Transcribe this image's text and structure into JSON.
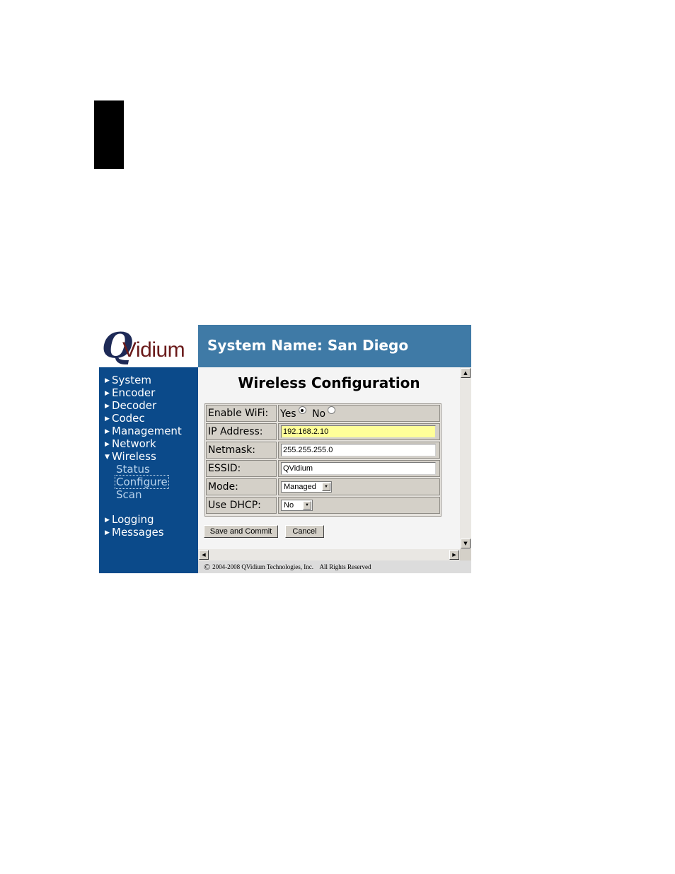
{
  "logo": {
    "initial": "Q",
    "word": "Vidium"
  },
  "banner": {
    "title": "System Name: San Diego"
  },
  "nav": {
    "items": [
      {
        "label": "System",
        "arrow": "▶"
      },
      {
        "label": "Encoder",
        "arrow": "▶"
      },
      {
        "label": "Decoder",
        "arrow": "▶"
      },
      {
        "label": "Codec",
        "arrow": "▶"
      },
      {
        "label": "Management",
        "arrow": "▶"
      },
      {
        "label": "Network",
        "arrow": "▶"
      },
      {
        "label": "Wireless",
        "arrow": "▼"
      },
      {
        "label": "Logging",
        "arrow": "▶"
      },
      {
        "label": "Messages",
        "arrow": "▶"
      }
    ],
    "wireless_sub": [
      "Status",
      "Configure",
      "Scan"
    ],
    "selected_sub": "Configure"
  },
  "page": {
    "title": "Wireless Configuration"
  },
  "form": {
    "enable_wifi": {
      "label": "Enable WiFi:",
      "yes": "Yes",
      "no": "No",
      "selected": "Yes"
    },
    "ip_address": {
      "label": "IP Address:",
      "value": "192.168.2.10"
    },
    "netmask": {
      "label": "Netmask:",
      "value": "255.255.255.0"
    },
    "essid": {
      "label": "ESSID:",
      "value": "QVidium"
    },
    "mode": {
      "label": "Mode:",
      "value": "Managed"
    },
    "use_dhcp": {
      "label": "Use DHCP:",
      "value": "No"
    }
  },
  "buttons": {
    "save": "Save and Commit",
    "cancel": "Cancel"
  },
  "footer": {
    "symbol": "©",
    "text": "2004-2008 QVidium Technologies, Inc.    All Rights Reserved"
  },
  "colors": {
    "nav_bg": "#0b4a8a",
    "banner_bg": "#3f7aa6",
    "highlight_field": "#ffff99"
  }
}
